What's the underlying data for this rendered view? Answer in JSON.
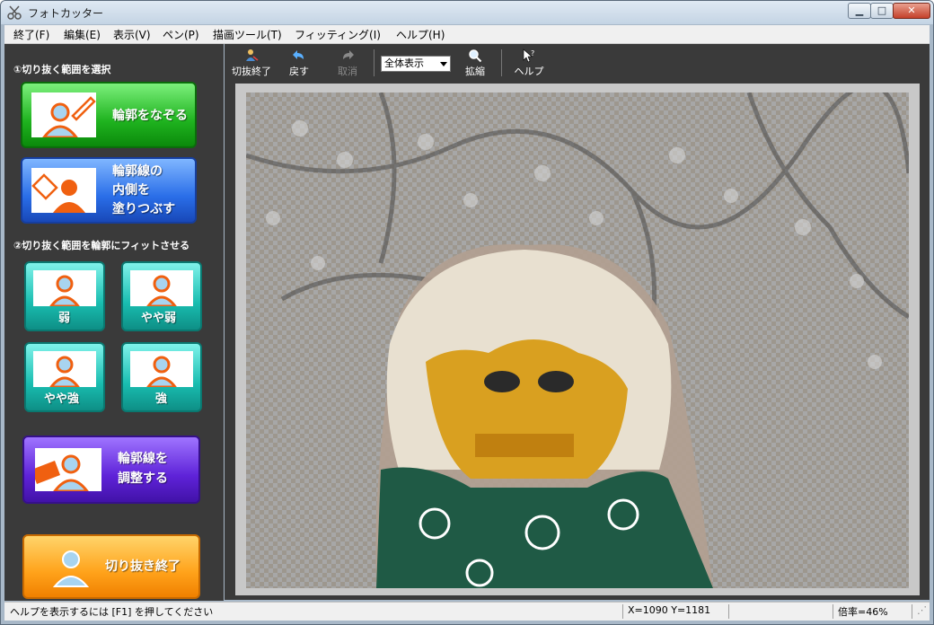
{
  "window": {
    "title": "フォトカッター"
  },
  "menu": [
    "終了(F)",
    "編集(E)",
    "表示(V)",
    "ペン(P)",
    "描画ツール(T)",
    "フィッティング(I)",
    "ヘルプ(H)"
  ],
  "toolbar": {
    "finish": "切抜終了",
    "undo": "戻す",
    "cancel": "取消",
    "view_select": "全体表示",
    "zoom": "拡縮",
    "help": "ヘルプ"
  },
  "sidebar": {
    "section1": "①切り抜く範囲を選択",
    "trace": "輪郭をなぞる",
    "fill_lines": [
      "輪郭線の",
      "内側を",
      "塗りつぶす"
    ],
    "section2": "②切り抜く範囲を輪郭にフィットさせる",
    "weak": "弱",
    "slightly_weak": "やや弱",
    "slightly_strong": "やや強",
    "strong": "強",
    "adjust_lines": [
      "輪郭線を",
      "調整する"
    ],
    "finish_cut": "切り抜き終了"
  },
  "status": {
    "hint": "ヘルプを表示するには [F1] を押してください",
    "coords": "X=1090 Y=1181",
    "zoom": "倍率=46%"
  },
  "icons": {
    "app": "scissors-icon",
    "person": "person-silhouette-icon",
    "pen": "pen-icon",
    "bucket": "paint-bucket-icon"
  },
  "colors": {
    "accent_orange": "#f06010",
    "person_fill": "#a8d4f0"
  }
}
